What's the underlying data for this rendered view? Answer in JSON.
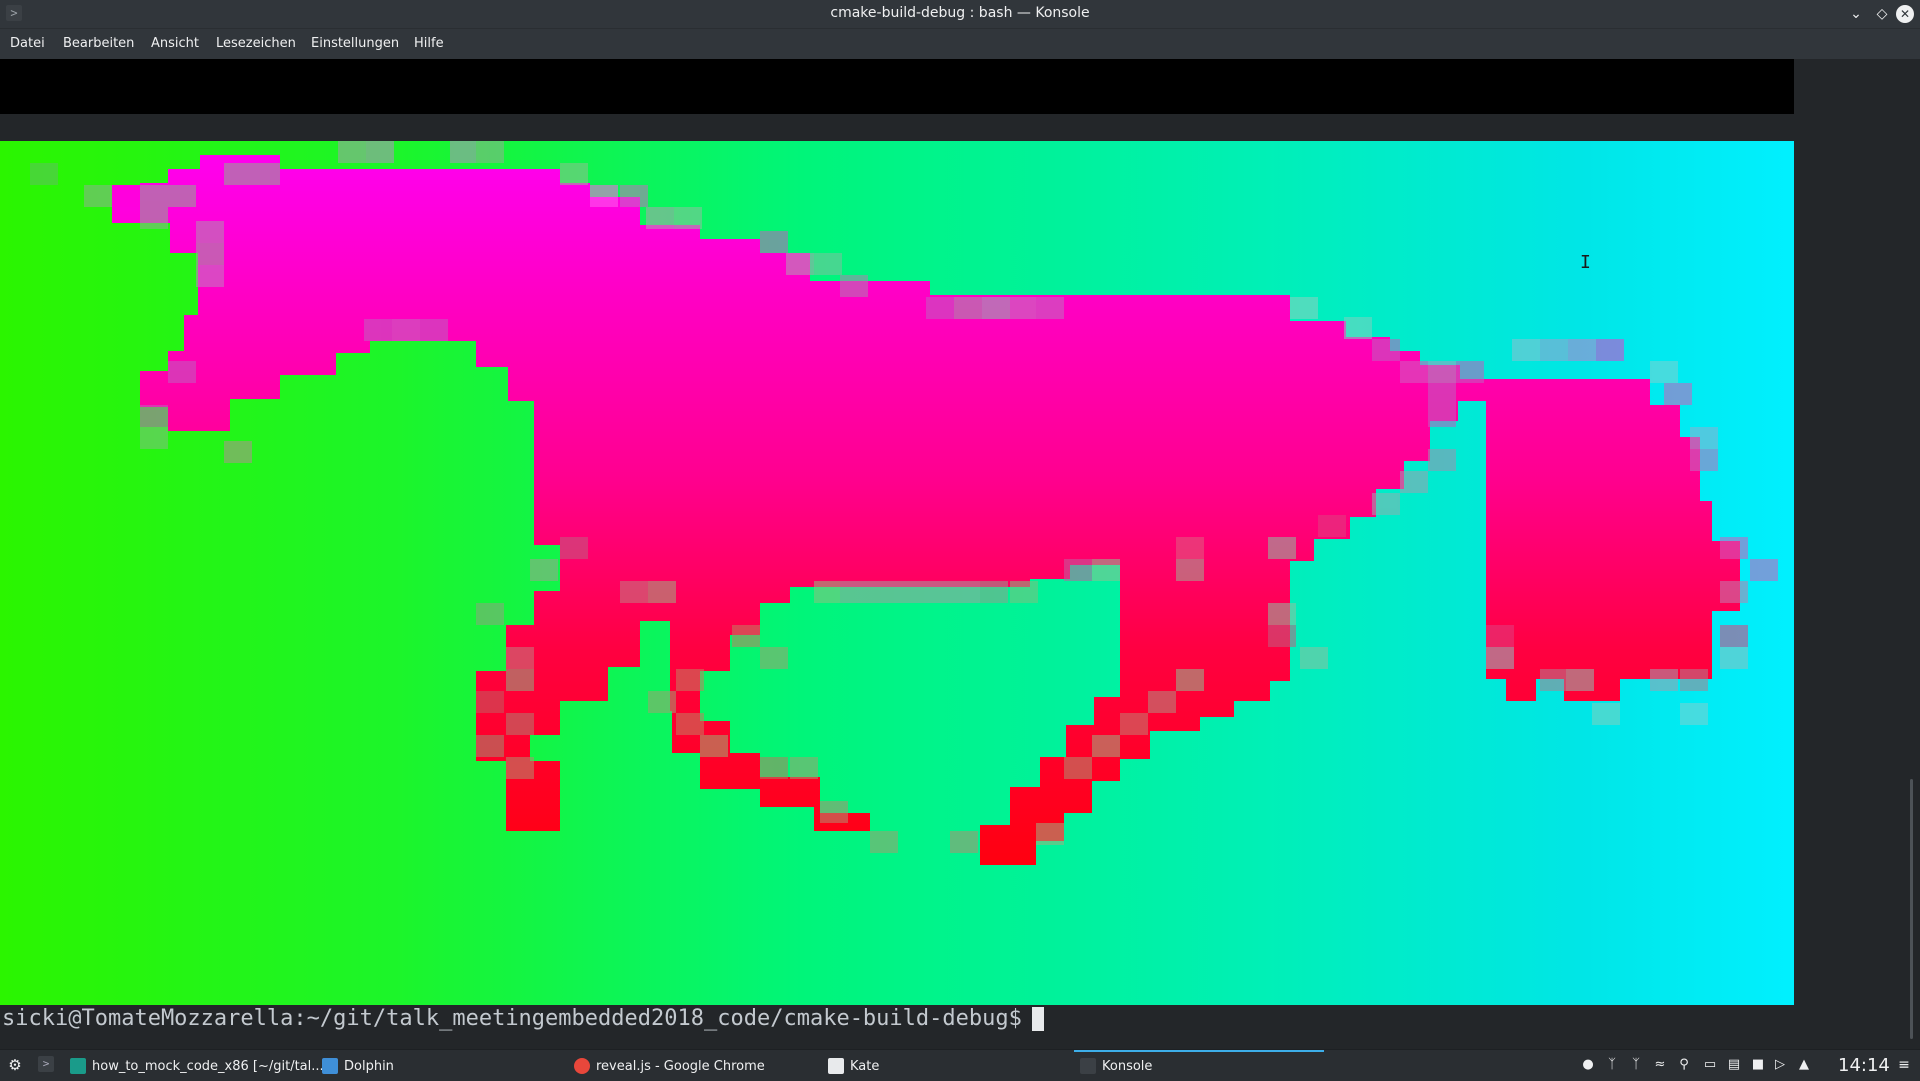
{
  "window": {
    "title": "cmake-build-debug : bash — Konsole",
    "app_icon": "terminal-icon",
    "controls": [
      "chevron-down-icon",
      "diamond-icon",
      "close-icon"
    ]
  },
  "menu": {
    "items": [
      "Datei",
      "Bearbeiten",
      "Ansicht",
      "Lesezeichen",
      "Einstellungen",
      "Hilfe"
    ]
  },
  "terminal": {
    "prompt": "sicki@TomateMozzarella:~/git/talk_meetingembedded2018_code/cmake-build-debug$",
    "image_colors": {
      "horse_top": "#ff00dd",
      "horse_bottom": "#ff0010",
      "background_left": "#2bf500",
      "background_right": "#00f0ff"
    }
  },
  "taskbar": {
    "tasks": [
      {
        "label": "how_to_mock_code_x86 [~/git/tal...",
        "icon": "clion-icon"
      },
      {
        "label": "Dolphin",
        "icon": "folder-icon"
      },
      {
        "label": "reveal.js - Google Chrome",
        "icon": "chrome-icon"
      },
      {
        "label": "Kate",
        "icon": "kate-icon"
      },
      {
        "label": "Konsole",
        "icon": "terminal-icon"
      }
    ],
    "tray_icons": [
      "user-icon",
      "bluetooth-icon",
      "bluetooth-icon",
      "wifi-icon",
      "network-icon",
      "battery-icon",
      "clipboard-icon",
      "lock-icon",
      "volume-icon",
      "arrow-up-icon"
    ],
    "clock": "14:14"
  }
}
